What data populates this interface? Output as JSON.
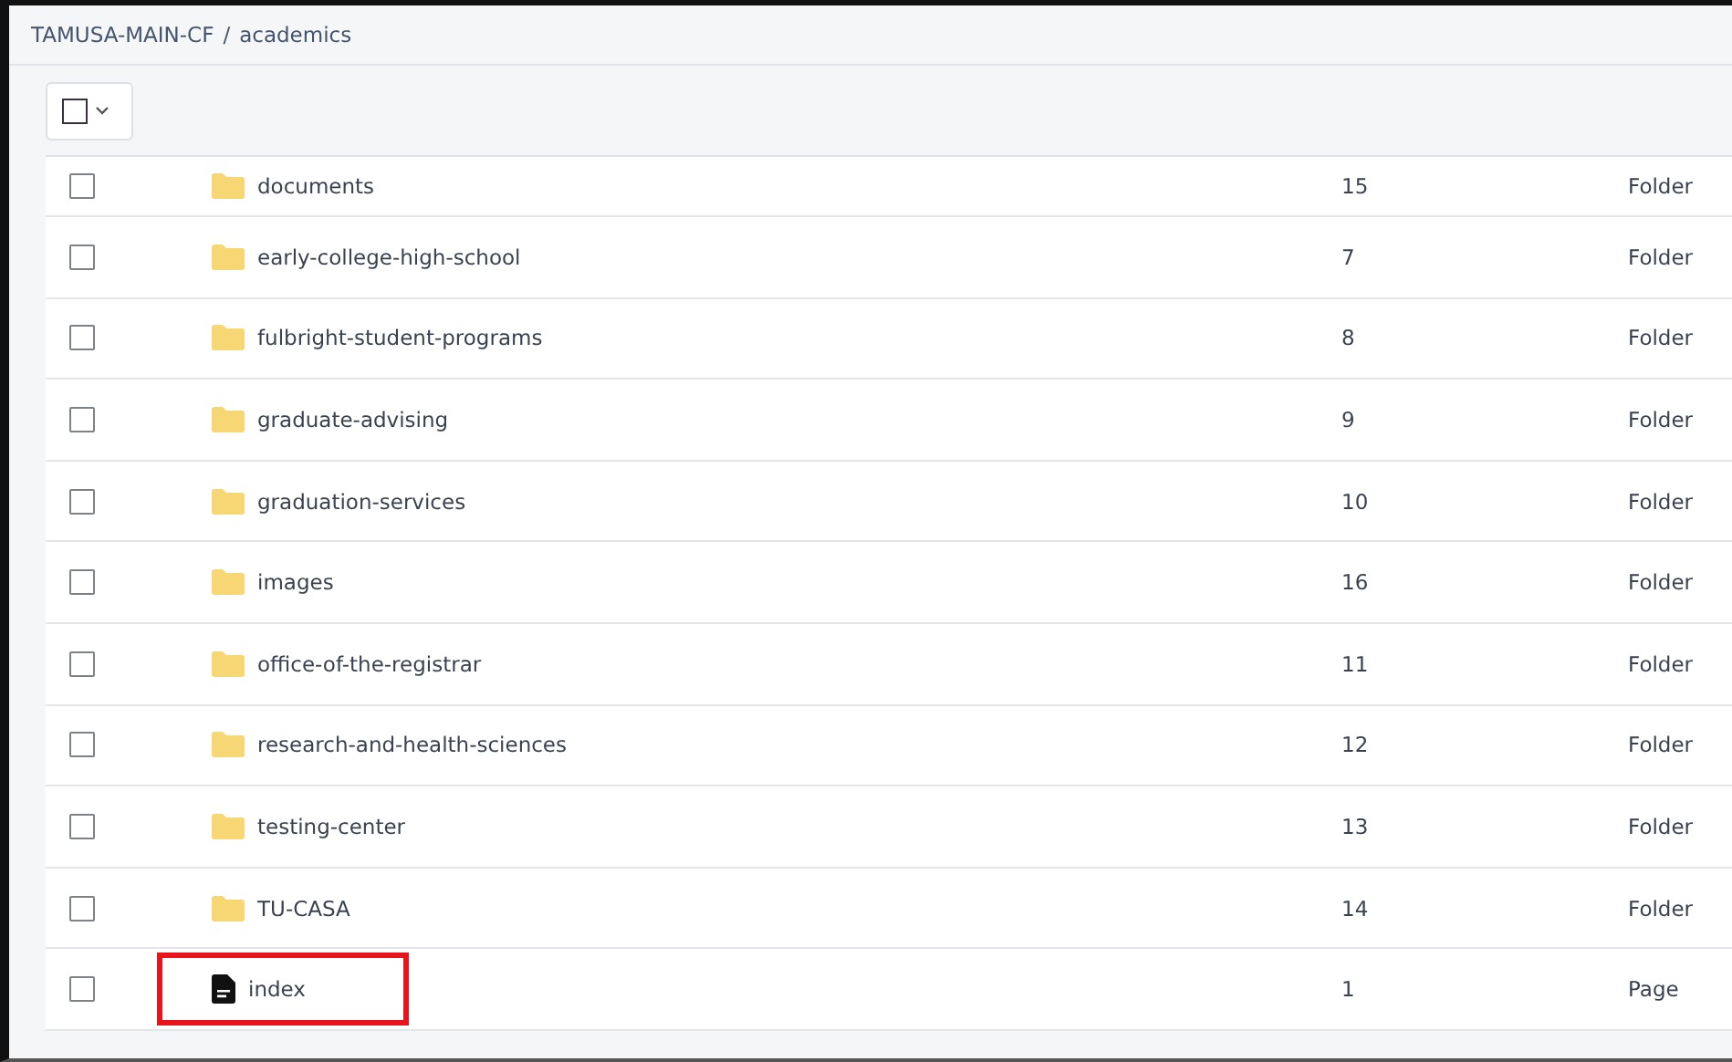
{
  "breadcrumb": {
    "root": "TAMUSA-MAIN-CF",
    "separator": "/",
    "current": "academics"
  },
  "toolbar": {
    "select_all": {
      "checked": false
    }
  },
  "rows": [
    {
      "kind": "folder",
      "name": "documents",
      "count": "15",
      "type": "Folder",
      "checked": false,
      "highlighted": false
    },
    {
      "kind": "folder",
      "name": "early-college-high-school",
      "count": "7",
      "type": "Folder",
      "checked": false,
      "highlighted": false
    },
    {
      "kind": "folder",
      "name": "fulbright-student-programs",
      "count": "8",
      "type": "Folder",
      "checked": false,
      "highlighted": false
    },
    {
      "kind": "folder",
      "name": "graduate-advising",
      "count": "9",
      "type": "Folder",
      "checked": false,
      "highlighted": false
    },
    {
      "kind": "folder",
      "name": "graduation-services",
      "count": "10",
      "type": "Folder",
      "checked": false,
      "highlighted": false
    },
    {
      "kind": "folder",
      "name": "images",
      "count": "16",
      "type": "Folder",
      "checked": false,
      "highlighted": false
    },
    {
      "kind": "folder",
      "name": "office-of-the-registrar",
      "count": "11",
      "type": "Folder",
      "checked": false,
      "highlighted": false
    },
    {
      "kind": "folder",
      "name": "research-and-health-sciences",
      "count": "12",
      "type": "Folder",
      "checked": false,
      "highlighted": false
    },
    {
      "kind": "folder",
      "name": "testing-center",
      "count": "13",
      "type": "Folder",
      "checked": false,
      "highlighted": false
    },
    {
      "kind": "folder",
      "name": "TU-CASA",
      "count": "14",
      "type": "Folder",
      "checked": false,
      "highlighted": false
    },
    {
      "kind": "page",
      "name": "index",
      "count": "1",
      "type": "Page",
      "checked": false,
      "highlighted": true
    }
  ]
}
